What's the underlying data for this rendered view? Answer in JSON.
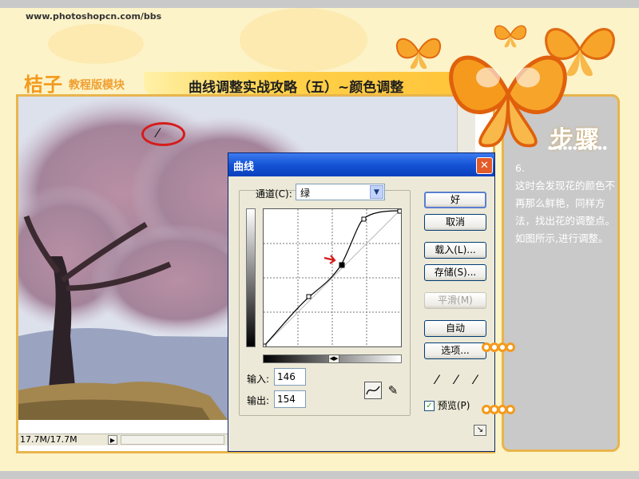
{
  "header": {
    "site_url": "www.photoshopcn.com/bbs",
    "brand_main": "桔子",
    "brand_sub": "教程版模块",
    "title": "曲线调整实战攻略（五）~颜色调整"
  },
  "image_window": {
    "status_text": "17.7M/17.7M"
  },
  "dialog": {
    "title": "曲线",
    "close_label": "✕",
    "channel_label": "通道(C):",
    "channel_value": "绿",
    "input_label": "输入:",
    "input_value": "146",
    "output_label": "输出:",
    "output_value": "154",
    "buttons": {
      "ok": "好",
      "cancel": "取消",
      "load": "载入(L)...",
      "save": "存储(S)...",
      "smooth": "平滑(M)",
      "auto": "自动",
      "options": "选项..."
    },
    "preview_label": "预览(P)",
    "preview_checked": true
  },
  "steps": {
    "title": "步骤",
    "text": "6.\n这时会发现花的颜色不再那么鲜艳，同样方法，找出花的调整点。如图所示,进行调整。"
  },
  "colors": {
    "accent_orange": "#f59a1c",
    "frame_gold": "#e8b54c",
    "dialog_title_blue": "#1453d4"
  }
}
